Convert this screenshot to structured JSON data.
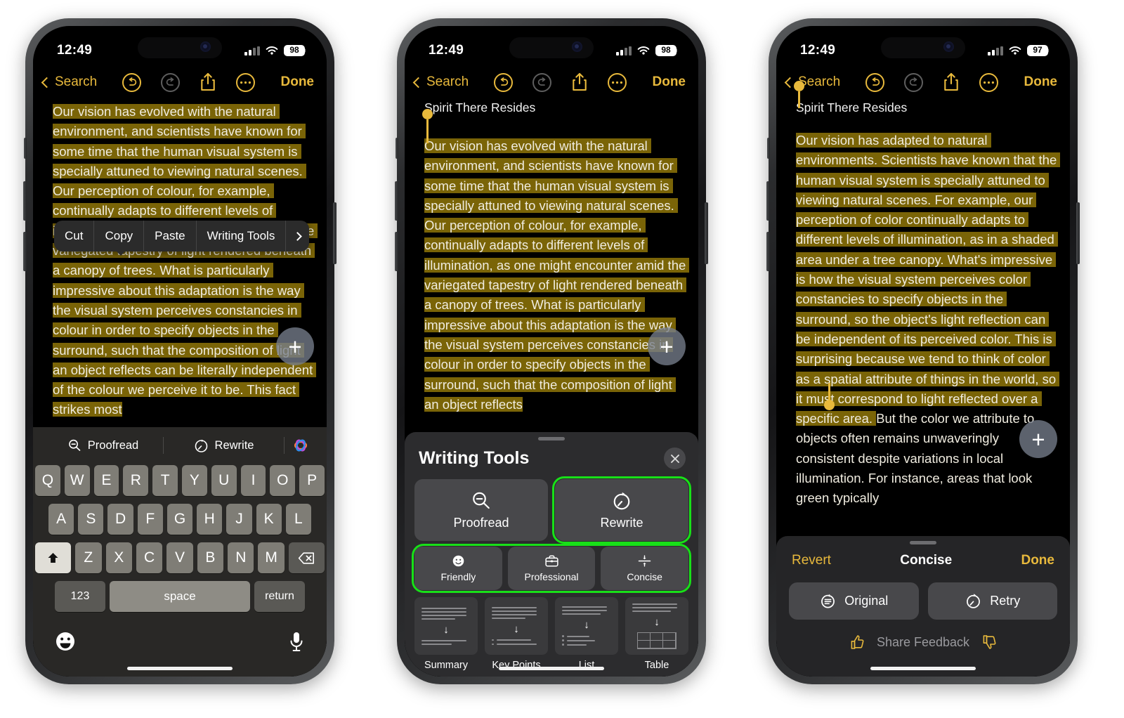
{
  "phones": [
    {
      "status": {
        "time": "12:49",
        "battery": "98"
      },
      "nav": {
        "back": "Search",
        "done": "Done"
      },
      "doc": {
        "title": "",
        "text_before": "Our vision has evolved with the natural environment, and scientists have known for some time that the human visual system is specially attuned to viewing natural scenes. Our perception of colour, for example, continually adapts to different levels of illumination, as one might encounter amid the variegated tapestry of light rendered beneath a canopy of trees. What is particularly impressive about this adaptation is the way the visual system perceives constancies in colour in order to specify objects in the surround, such that the composition of light an object reflects can be literally independent of the colour we perceive it to be. This fact strikes most"
      },
      "context_menu": [
        "Cut",
        "Copy",
        "Paste",
        "Writing Tools"
      ],
      "keyboard": {
        "toolbar": {
          "proofread": "Proofread",
          "rewrite": "Rewrite",
          "ai_icon": "apple-intelligence-icon"
        },
        "row1": [
          "Q",
          "W",
          "E",
          "R",
          "T",
          "Y",
          "U",
          "I",
          "O",
          "P"
        ],
        "row2": [
          "A",
          "S",
          "D",
          "F",
          "G",
          "H",
          "J",
          "K",
          "L"
        ],
        "row3": [
          "Z",
          "X",
          "C",
          "V",
          "B",
          "N",
          "M"
        ],
        "numbers_key": "123",
        "space_key": "space",
        "return_key": "return"
      },
      "fab": "+"
    },
    {
      "status": {
        "time": "12:49",
        "battery": "98"
      },
      "nav": {
        "back": "Search",
        "done": "Done"
      },
      "doc": {
        "title": "Spirit There Resides",
        "text": "Our vision has evolved with the natural environment, and scientists have known for some time that the human visual system is specially attuned to viewing natural scenes. Our perception of colour, for example, continually adapts to different levels of illumination, as one might encounter amid the variegated tapestry of light rendered beneath a canopy of trees. What is particularly impressive about this adaptation is the way the visual system perceives constancies in colour in order to specify objects in the surround, such that the composition of light an object reflects"
      },
      "writing_tools": {
        "title": "Writing Tools",
        "close": "×",
        "primary": [
          {
            "label": "Proofread",
            "icon": "magnifier-minus-icon",
            "highlighted": false
          },
          {
            "label": "Rewrite",
            "icon": "rewrite-clock-icon",
            "highlighted": true
          }
        ],
        "tones": [
          {
            "label": "Friendly",
            "icon": "smiley-icon"
          },
          {
            "label": "Professional",
            "icon": "briefcase-icon"
          },
          {
            "label": "Concise",
            "icon": "compress-icon"
          }
        ],
        "tones_highlighted": true,
        "formats": [
          {
            "label": "Summary",
            "icon": "summary-icon"
          },
          {
            "label": "Key Points",
            "icon": "key-points-icon"
          },
          {
            "label": "List",
            "icon": "list-icon"
          },
          {
            "label": "Table",
            "icon": "table-icon"
          }
        ]
      },
      "fab": "+"
    },
    {
      "status": {
        "time": "12:49",
        "battery": "97"
      },
      "nav": {
        "back": "Search",
        "done": "Done"
      },
      "doc": {
        "title": "Spirit There Resides",
        "text_highlighted": "Our vision has adapted to natural environments. Scientists have known that the human visual system is specially attuned to viewing natural scenes. For example, our perception of color continually adapts to different levels of illumination, as in a shaded area under a tree canopy. What's impressive is how the visual system perceives color constancies to specify objects in the surround, so the object's light reflection can be independent of its perceived color. This is surprising because we tend to think of color as a spatial attribute of things in the world, so it must correspond to light reflected over a specific area. ",
        "text_plain": "But the color we attribute to objects often remains unwaveringly consistent despite variations in local illumination. For instance, areas that look green typically"
      },
      "result_sheet": {
        "revert": "Revert",
        "title": "Concise",
        "done": "Done",
        "buttons": [
          {
            "label": "Original",
            "icon": "original-undo-icon"
          },
          {
            "label": "Retry",
            "icon": "retry-clock-icon"
          }
        ],
        "feedback": {
          "label": "Share Feedback",
          "thumbs_up": "thumbs-up-icon",
          "thumbs_down": "thumbs-down-icon"
        }
      },
      "fab": "+"
    }
  ],
  "colors": {
    "accent_yellow": "#e8b93c",
    "highlight_olive": "#7a6407",
    "sheet_gray": "#2c2c2e",
    "button_gray": "#48484b",
    "focus_green": "#18e018"
  }
}
